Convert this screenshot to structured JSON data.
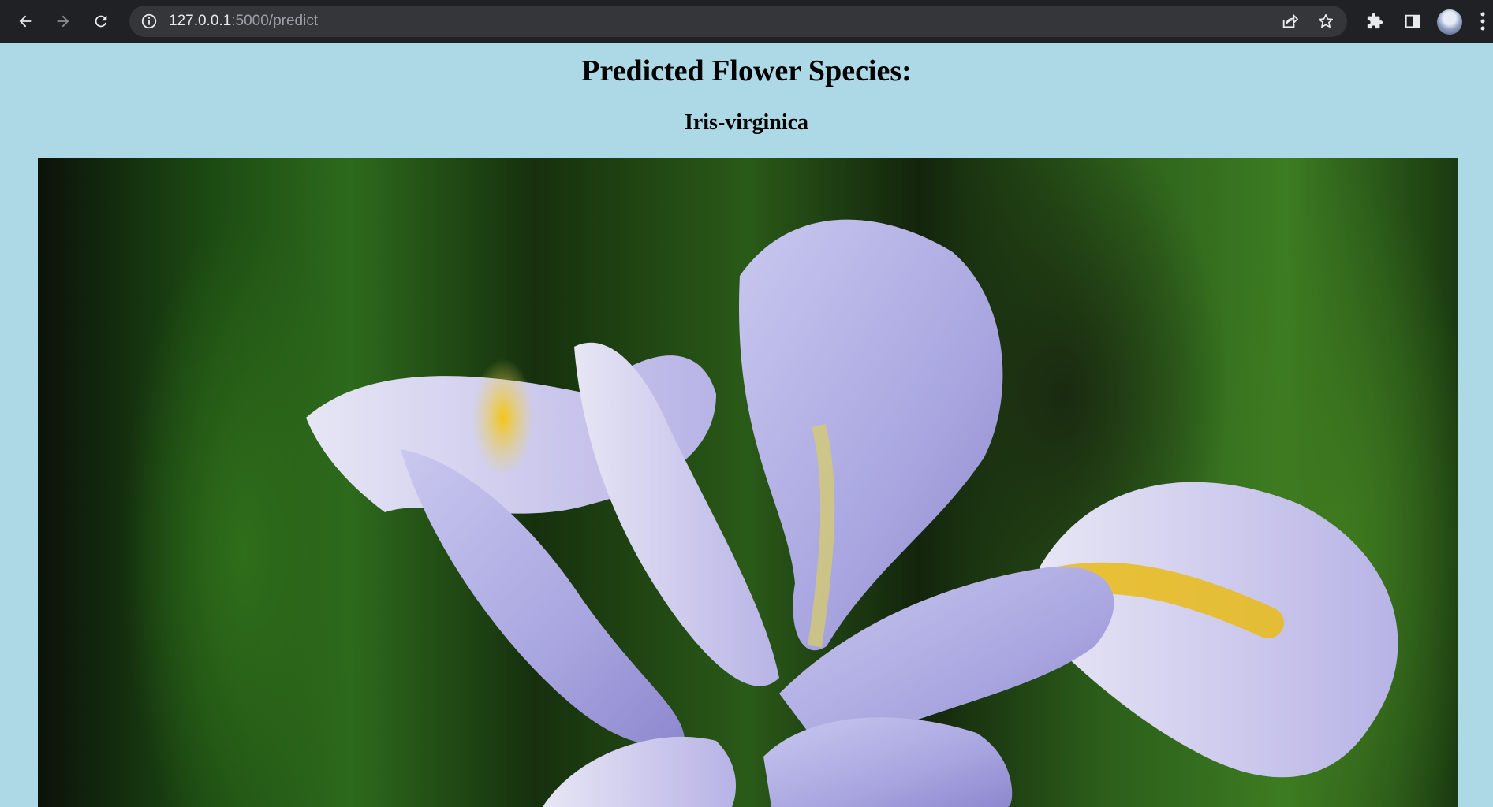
{
  "browser": {
    "url_host": "127.0.0.1",
    "url_rest": ":5000/predict",
    "icons": [
      "back-icon",
      "forward-icon",
      "reload-icon",
      "info-icon",
      "share-icon",
      "star-icon",
      "extensions-icon",
      "sidepanel-icon",
      "profile-avatar",
      "menu-icon"
    ]
  },
  "page": {
    "title": "Predicted Flower Species:",
    "prediction": "Iris-virginica"
  }
}
